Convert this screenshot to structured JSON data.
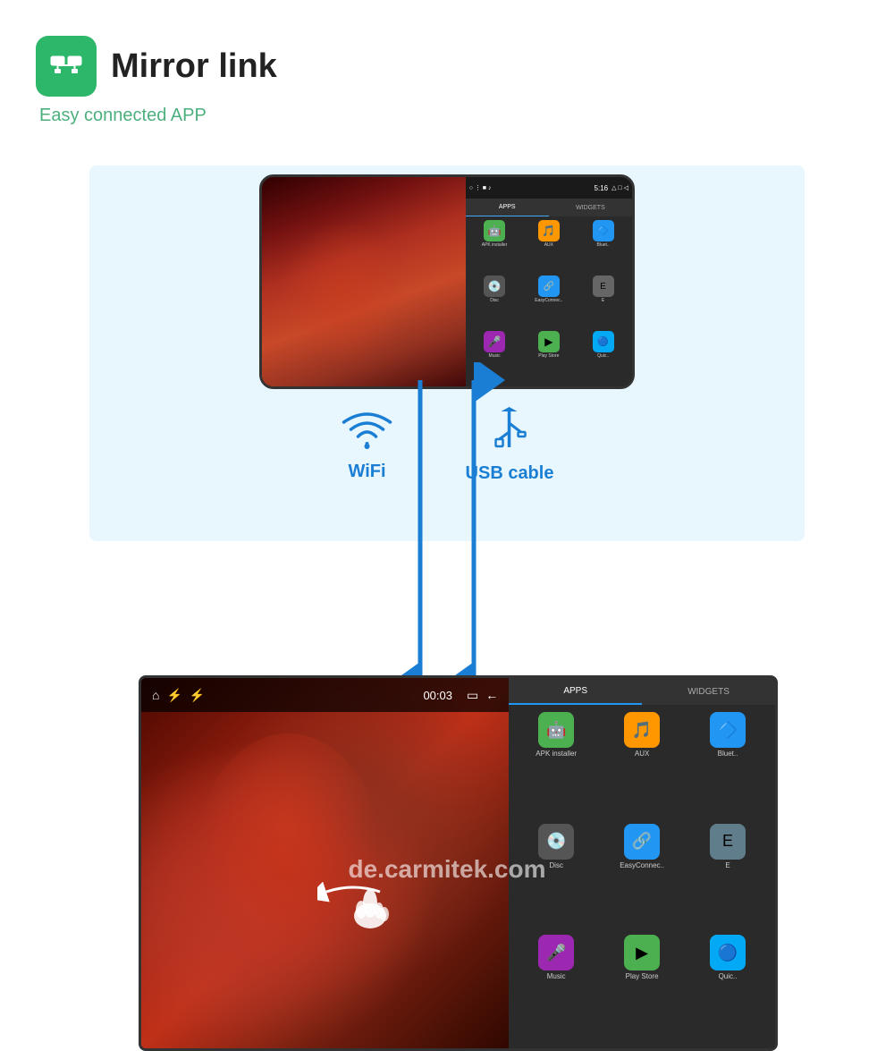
{
  "header": {
    "title": "Mirror link",
    "subtitle": "Easy connected APP",
    "icon_bg": "#2db76a"
  },
  "connection": {
    "wifi_label": "WiFi",
    "usb_label": "USB cable"
  },
  "phone": {
    "status_bar": "5:16",
    "tabs": [
      "APPS",
      "WIDGETS"
    ],
    "apps": [
      {
        "label": "APK installer",
        "color": "#4CAF50",
        "symbol": "🤖"
      },
      {
        "label": "AUX",
        "color": "#FF9800",
        "symbol": "🎵"
      },
      {
        "label": "Bluet..",
        "color": "#2196F3",
        "symbol": "🔷"
      },
      {
        "label": "Disc",
        "color": "#333",
        "symbol": "💿"
      },
      {
        "label": "EasyConnec..",
        "color": "#2196F3",
        "symbol": "🔗"
      },
      {
        "label": "E",
        "color": "#666",
        "symbol": "📱"
      },
      {
        "label": "Music",
        "color": "#9C27B0",
        "symbol": "🎤"
      },
      {
        "label": "Play Store",
        "color": "#4CAF50",
        "symbol": "▶"
      },
      {
        "label": "Quic..",
        "color": "#03A9F4",
        "symbol": "🔵"
      }
    ]
  },
  "car_screen": {
    "status_time": "00:03",
    "tabs": [
      "APPS",
      "WIDGETS"
    ],
    "apps": [
      {
        "label": "APK installer",
        "color": "#4CAF50",
        "symbol": "🤖"
      },
      {
        "label": "AUX",
        "color": "#FF9800",
        "symbol": "🎵"
      },
      {
        "label": "Bluet..",
        "color": "#2196F3",
        "symbol": "🔷"
      },
      {
        "label": "Disc",
        "color": "#333",
        "symbol": "💿"
      },
      {
        "label": "EasyConnec..",
        "color": "#2196F3",
        "symbol": "🔗"
      },
      {
        "label": "E",
        "color": "#666",
        "symbol": "📱"
      },
      {
        "label": "Music",
        "color": "#9C27B0",
        "symbol": "🎤"
      },
      {
        "label": "Play Store",
        "color": "#4CAF50",
        "symbol": "▶"
      },
      {
        "label": "Quic..",
        "color": "#03A9F4",
        "symbol": "🔵"
      }
    ]
  },
  "watermark": "de.carmitek.com"
}
